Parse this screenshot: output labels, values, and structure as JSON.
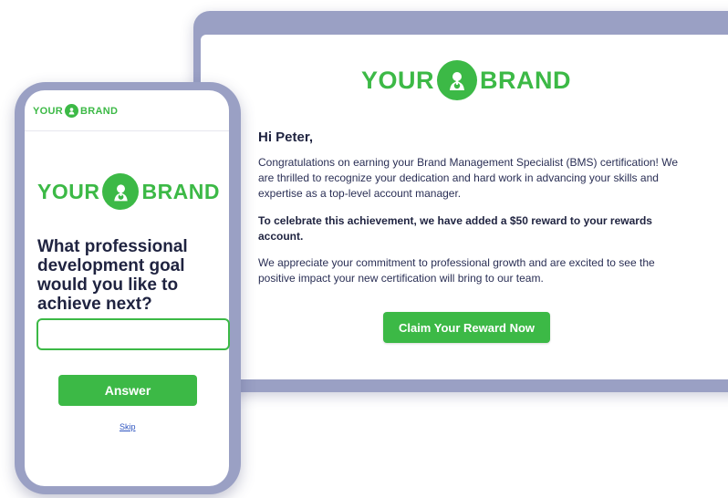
{
  "brand": {
    "left": "YOUR",
    "right": "BRAND",
    "color": "#3cb946",
    "mark_icon": "mascot-pointing-icon"
  },
  "email": {
    "greeting": "Hi Peter,",
    "paragraph1": "Congratulations on earning your Brand Management Specialist (BMS) certification! We are thrilled to recognize your dedication and hard work in advancing your skills and expertise as a top-level account manager.",
    "paragraph2": "To celebrate this achievement, we have added a $50 reward to your rewards account.",
    "paragraph3": "We appreciate your commitment to professional growth and are excited to see the positive impact your new certification will bring to our team.",
    "cta_label": "Claim Your Reward  Now"
  },
  "phone": {
    "question": "What professional development goal would you like to achieve next?",
    "input_value": "",
    "answer_label": "Answer",
    "skip_label": "Skip"
  },
  "colors": {
    "frame": "#9aa0c4",
    "accent": "#3cb946",
    "text": "#1f2340",
    "link": "#2f55c0"
  }
}
